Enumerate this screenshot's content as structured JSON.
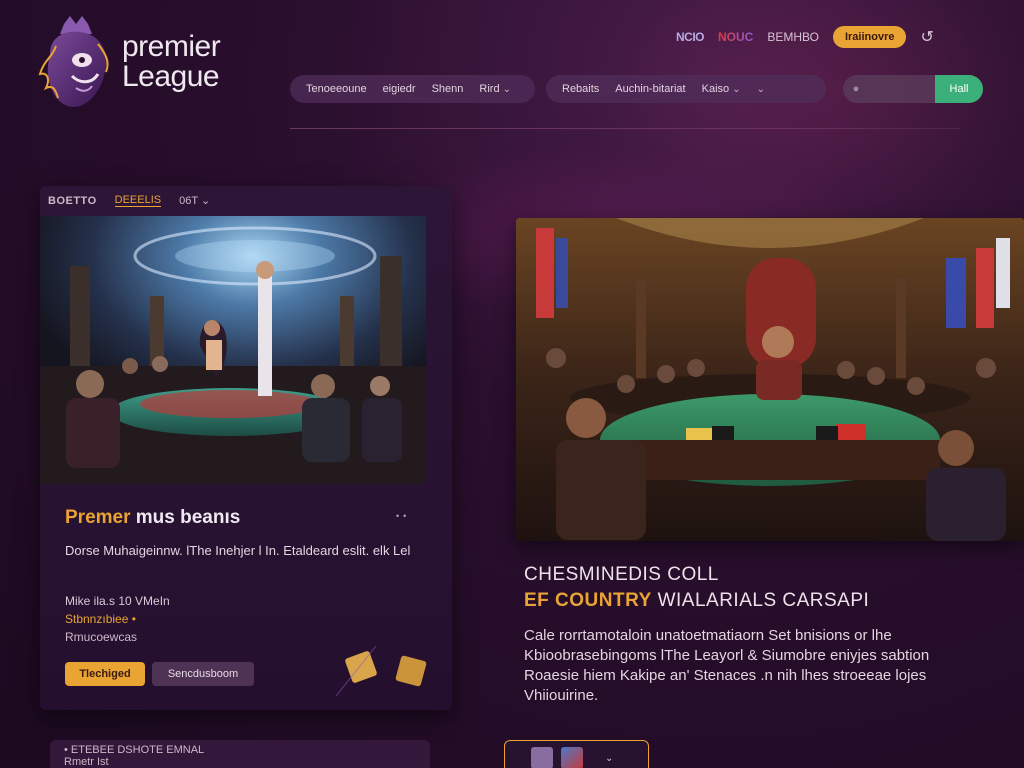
{
  "brand": {
    "line1": "premier",
    "line2": "League"
  },
  "top_links": {
    "link1": "NCIO",
    "link2": "NOUC",
    "link3": "ВЕМНВО",
    "cta": "Iraiinovre"
  },
  "nav": {
    "group1": [
      "Tenoeeoune",
      "eigiedr",
      "Shenn",
      "Rird"
    ],
    "group2": [
      "Rebaits",
      "Auchin-bitariat",
      "Kaiso"
    ]
  },
  "search": {
    "placeholder": "",
    "button": "Hall"
  },
  "left_card": {
    "tab_logo": "BOETTO",
    "tab_active": "DEEELIS",
    "tab_3": "06T",
    "title_gold": "Premer",
    "title_white": "mus beanıs",
    "description": "Dorse Muhaigeinnw. lThe Inehjer l In. Etaldeard eslit. elk Lel",
    "meta_1": "Mike ila.s 10 VMeIn",
    "meta_2": "Stbnnzıbiee •",
    "meta_3": "Rmucoewcas",
    "button_primary": "Tlechiged",
    "button_secondary": "Sencdusboom"
  },
  "bottom_card": {
    "line1": "• ETEBEE DSHOTE EMNAL",
    "line2": "Rmetr Ist"
  },
  "right_section": {
    "heading_line1": "CHESMINEDIS COLL",
    "heading_gold": "EF COUNTRY",
    "heading_white": "WIALARIALS CARSAPI",
    "description": "Cale rorrtamotaloin unatoetmatiaorn Set bnisions or lhe Kbioobrasebingoms lThe Leayorl & Siumobre eniyjes sabtion Roaesie hiem Kakipe an' Stenaces .n nih lhes stroeeae lojes Vhiiouirine."
  },
  "colors": {
    "accent_gold": "#e9a434",
    "accent_green": "#3bb07a",
    "background": "#2a0f2e"
  }
}
